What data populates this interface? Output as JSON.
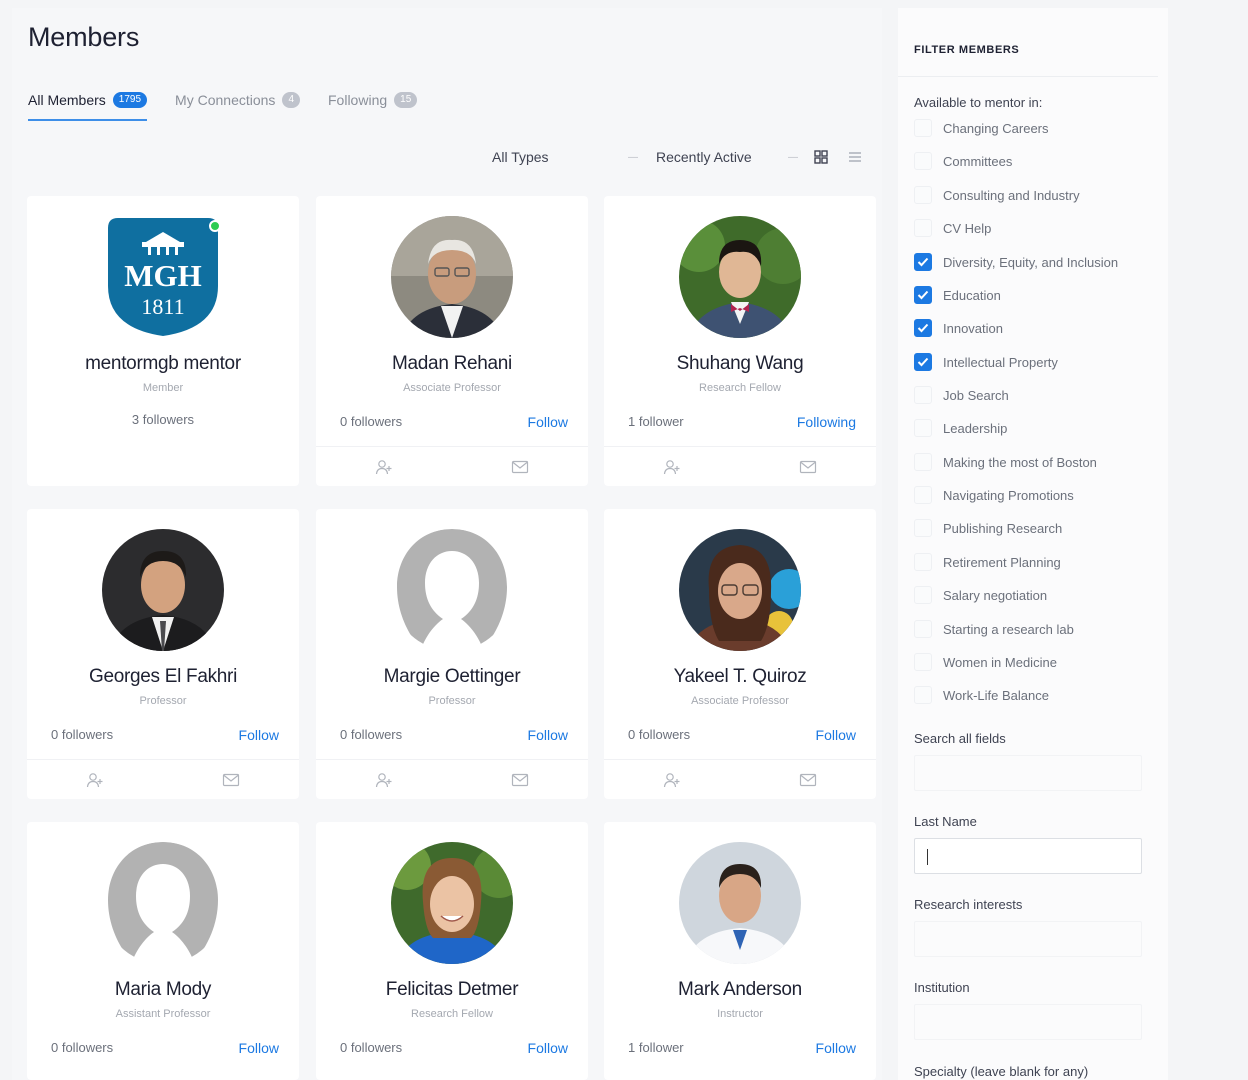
{
  "page": {
    "title": "Members"
  },
  "tabs": [
    {
      "label": "All Members",
      "count": "1795",
      "active": true
    },
    {
      "label": "My Connections",
      "count": "4",
      "active": false
    },
    {
      "label": "Following",
      "count": "15",
      "active": false
    }
  ],
  "toolbar": {
    "type_filter": "All Types",
    "sort": "Recently Active",
    "grid_view_icon": "grid-view-icon",
    "list_view_icon": "list-view-icon"
  },
  "members": [
    {
      "name": "mentormgb mentor",
      "role": "Member",
      "followers": "3 followers",
      "follow": "",
      "online": true,
      "avatar": "mgh-logo"
    },
    {
      "name": "Madan Rehani",
      "role": "Associate Professor",
      "followers": "0 followers",
      "follow": "Follow",
      "avatar": "photo"
    },
    {
      "name": "Shuhang Wang",
      "role": "Research Fellow",
      "followers": "1 follower",
      "follow": "Following",
      "avatar": "photo"
    },
    {
      "name": "Georges El Fakhri",
      "role": "Professor",
      "followers": "0 followers",
      "follow": "Follow",
      "avatar": "photo"
    },
    {
      "name": "Margie Oettinger",
      "role": "Professor",
      "followers": "0 followers",
      "follow": "Follow",
      "avatar": "placeholder"
    },
    {
      "name": "Yakeel T. Quiroz",
      "role": "Associate Professor",
      "followers": "0 followers",
      "follow": "Follow",
      "avatar": "photo"
    },
    {
      "name": "Maria Mody",
      "role": "Assistant Professor",
      "followers": "0 followers",
      "follow": "Follow",
      "avatar": "placeholder"
    },
    {
      "name": "Felicitas Detmer",
      "role": "Research Fellow",
      "followers": "0 followers",
      "follow": "Follow",
      "avatar": "photo"
    },
    {
      "name": "Mark Anderson",
      "role": "Instructor",
      "followers": "1 follower",
      "follow": "Follow",
      "avatar": "photo"
    }
  ],
  "logo": {
    "line1": "MGH",
    "line2": "1811"
  },
  "sidebar": {
    "title": "FILTER MEMBERS",
    "mentor_label": "Available to mentor in:",
    "mentor_options": [
      {
        "label": "Changing Careers",
        "checked": false
      },
      {
        "label": "Committees",
        "checked": false
      },
      {
        "label": "Consulting and Industry",
        "checked": false
      },
      {
        "label": "CV Help",
        "checked": false
      },
      {
        "label": "Diversity, Equity, and Inclusion",
        "checked": true
      },
      {
        "label": "Education",
        "checked": true
      },
      {
        "label": "Innovation",
        "checked": true
      },
      {
        "label": "Intellectual Property",
        "checked": true
      },
      {
        "label": "Job Search",
        "checked": false
      },
      {
        "label": "Leadership",
        "checked": false
      },
      {
        "label": "Making the most of Boston",
        "checked": false
      },
      {
        "label": "Navigating Promotions",
        "checked": false
      },
      {
        "label": "Publishing Research",
        "checked": false
      },
      {
        "label": "Retirement Planning",
        "checked": false
      },
      {
        "label": "Salary negotiation",
        "checked": false
      },
      {
        "label": "Starting a research lab",
        "checked": false
      },
      {
        "label": "Women in Medicine",
        "checked": false
      },
      {
        "label": "Work-Life Balance",
        "checked": false
      }
    ],
    "search_all_label": "Search all fields",
    "search_all_value": "",
    "last_name_label": "Last Name",
    "last_name_value": "",
    "research_label": "Research interests",
    "research_value": "",
    "institution_label": "Institution",
    "institution_value": "",
    "specialty_label": "Specialty (leave blank for any)"
  },
  "colors": {
    "accent": "#1c79e2",
    "online": "#2ecc52",
    "mgh_teal": "#0f6fa0"
  }
}
